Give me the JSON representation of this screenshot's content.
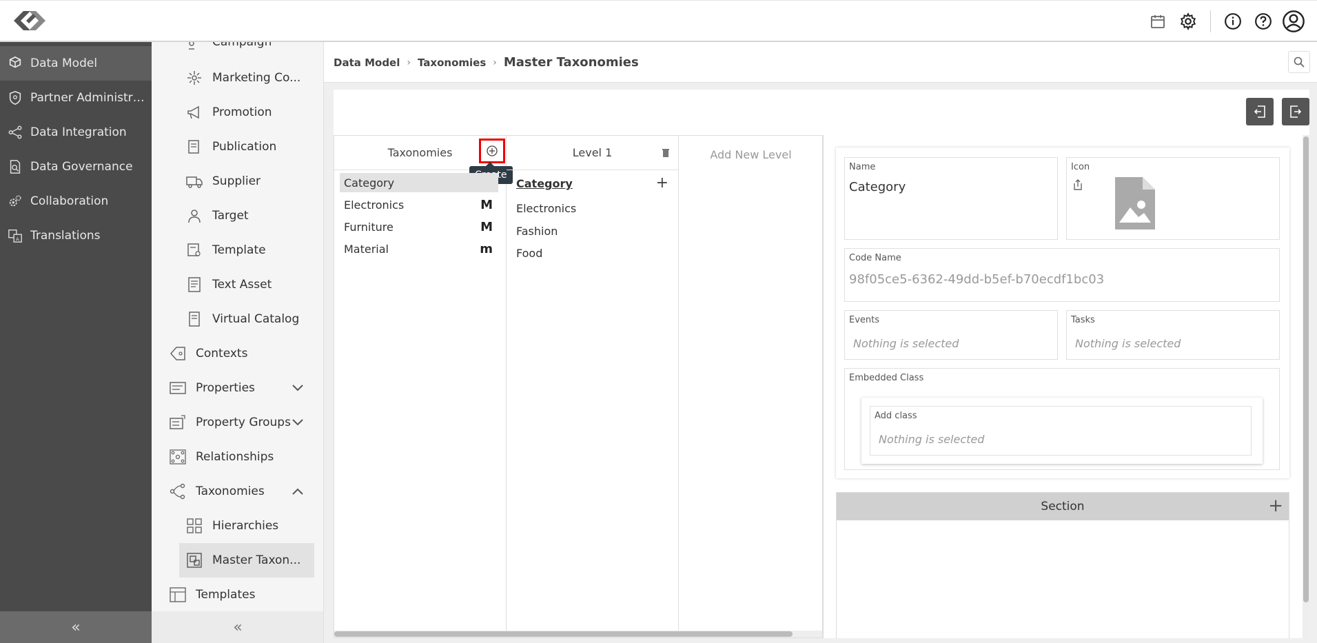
{
  "sidebar_dark": {
    "items": [
      {
        "label": "Data Model",
        "icon": "cubes-icon",
        "active": true
      },
      {
        "label": "Partner Administrati...",
        "icon": "shield-icon"
      },
      {
        "label": "Data Integration",
        "icon": "share-nodes-icon"
      },
      {
        "label": "Data Governance",
        "icon": "document-search-icon"
      },
      {
        "label": "Collaboration",
        "icon": "gears-icon"
      },
      {
        "label": "Translations",
        "icon": "translate-icon"
      }
    ],
    "collapse_label": "«"
  },
  "sidebar_light": {
    "items": [
      {
        "label": "Campaign",
        "icon": "campaign-icon"
      },
      {
        "label": "Marketing Co...",
        "icon": "marketing-icon"
      },
      {
        "label": "Promotion",
        "icon": "megaphone-icon"
      },
      {
        "label": "Publication",
        "icon": "publication-icon"
      },
      {
        "label": "Supplier",
        "icon": "truck-icon"
      },
      {
        "label": "Target",
        "icon": "person-icon"
      },
      {
        "label": "Template",
        "icon": "template-icon"
      },
      {
        "label": "Text Asset",
        "icon": "text-asset-icon"
      },
      {
        "label": "Virtual Catalog",
        "icon": "catalog-icon"
      },
      {
        "label": "Contexts",
        "icon": "tag-icon"
      },
      {
        "label": "Properties",
        "icon": "properties-icon"
      },
      {
        "label": "Property Groups",
        "icon": "property-groups-icon"
      },
      {
        "label": "Relationships",
        "icon": "relationships-icon"
      },
      {
        "label": "Taxonomies",
        "icon": "taxonomy-icon"
      },
      {
        "label": "Hierarchies",
        "icon": "hierarchy-icon"
      },
      {
        "label": "Master Taxon...",
        "icon": "master-taxonomy-icon",
        "active": true
      },
      {
        "label": "Templates",
        "icon": "templates-icon"
      }
    ],
    "collapse_label": "«"
  },
  "breadcrumb": {
    "items": [
      "Data Model",
      "Taxonomies"
    ],
    "separator": "›",
    "current": "Master Taxonomies"
  },
  "taxonomies": {
    "header": "Taxonomies",
    "create_tooltip": "Create",
    "rows": [
      {
        "label": "Category",
        "mark": ""
      },
      {
        "label": "Electronics",
        "mark": "M"
      },
      {
        "label": "Furniture",
        "mark": "M"
      },
      {
        "label": "Material",
        "mark": "m"
      }
    ]
  },
  "level1": {
    "header": "Level 1",
    "root": "Category",
    "add": "+",
    "items": [
      "Electronics",
      "Fashion",
      "Food"
    ]
  },
  "add_new_level": "Add New Level",
  "detail": {
    "name_label": "Name",
    "name_value": "Category",
    "icon_label": "Icon",
    "code_label": "Code Name",
    "code_value": "98f05ce5-6362-49dd-b5ef-b70ecdf1bc03",
    "events_label": "Events",
    "events_placeholder": "Nothing is selected",
    "tasks_label": "Tasks",
    "tasks_placeholder": "Nothing is selected",
    "embedded_label": "Embedded Class",
    "add_class_label": "Add class",
    "add_class_placeholder": "Nothing is selected",
    "section_label": "Section",
    "section_add": "+"
  },
  "colors": {
    "sidebar_dark": "#4a4a4a",
    "sidebar_active": "#5e5e5e",
    "highlight": "#e00000",
    "tooltip": "#2e3b45"
  }
}
